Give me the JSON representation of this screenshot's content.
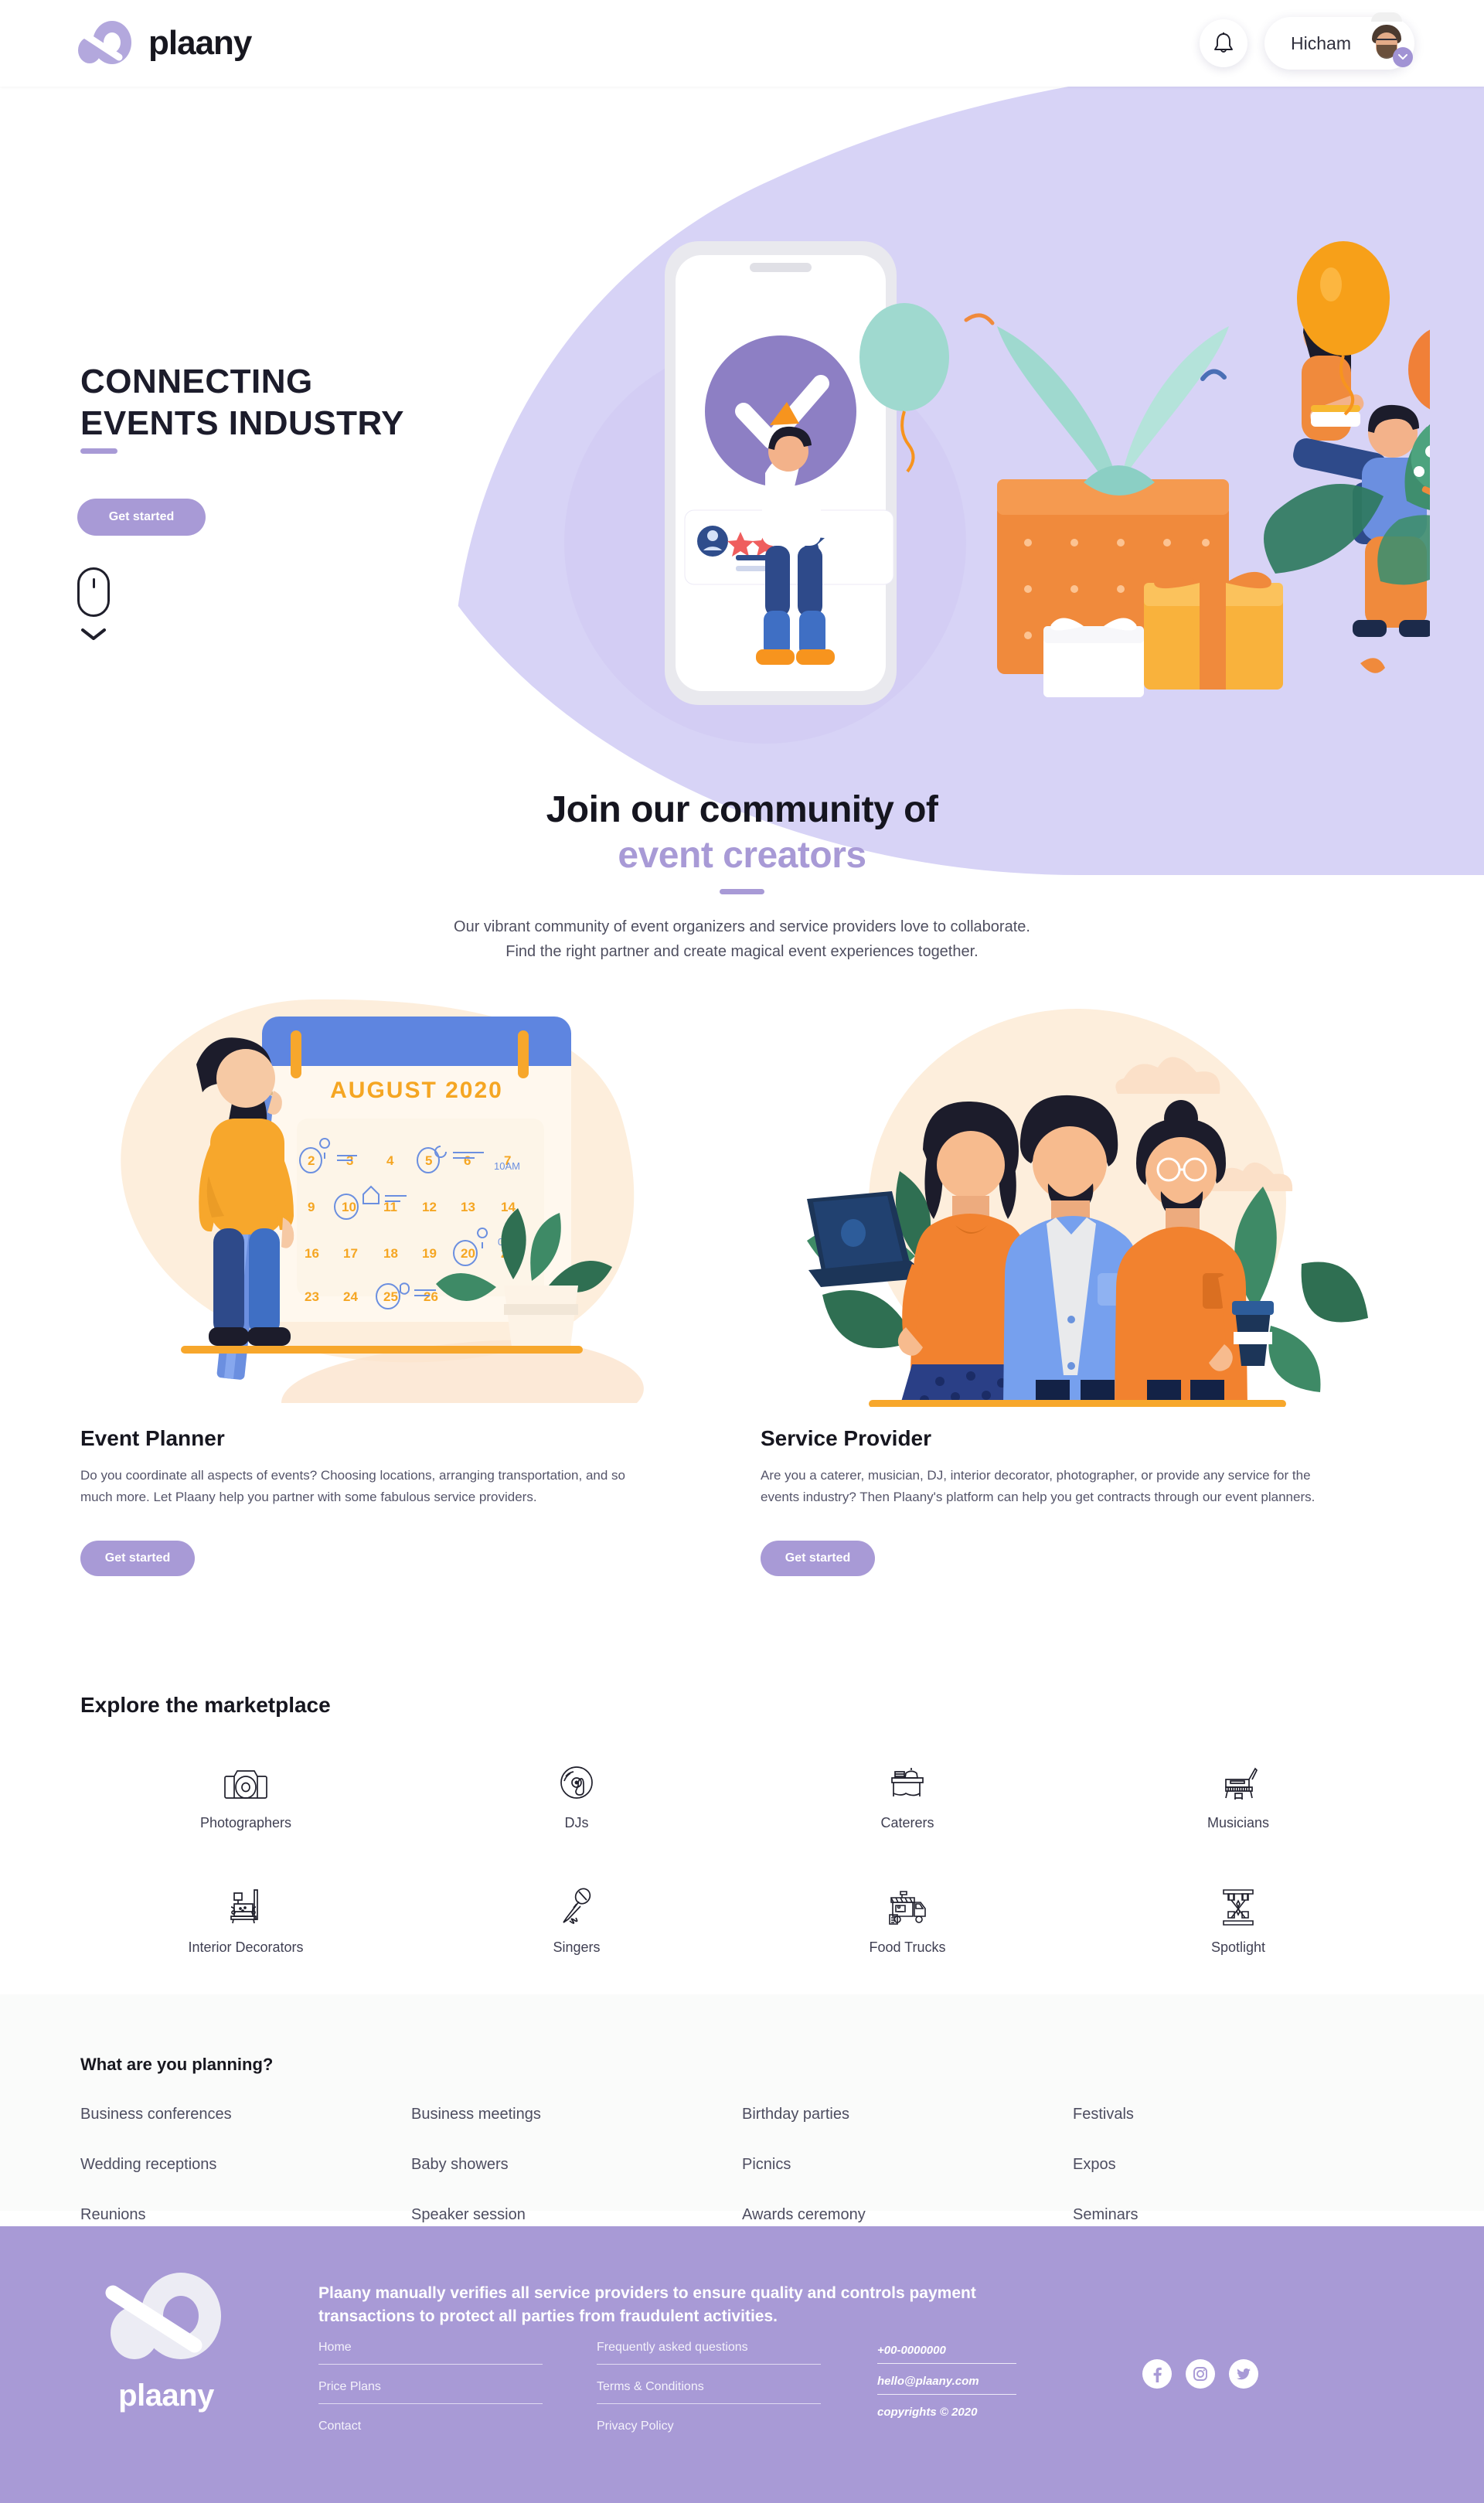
{
  "header": {
    "brand_name": "plaany",
    "notifications_icon": "bell-icon",
    "user_name": "Hicham",
    "chevron_icon": "chevron-down-icon"
  },
  "hero": {
    "title_line1": "CONNECTING",
    "title_line2": "EVENTS INDUSTRY",
    "cta_label": "Get started",
    "scroll_hint_icon": "mouse-scroll-icon"
  },
  "community": {
    "heading_line1": "Join our community of",
    "heading_line2": "event creators",
    "subtitle": "Our vibrant community of event organizers and service providers love to collaborate. Find the right partner and create magical event experiences together."
  },
  "roles": [
    {
      "title": "Event Planner",
      "description": "Do you coordinate all aspects of events? Choosing locations, arranging transportation, and so much more. Let Plaany help you partner with some fabulous service providers.",
      "cta_label": "Get started",
      "illustration": "woman-with-pencil-and-calendar",
      "calendar_title": "AUGUST 2020"
    },
    {
      "title": "Service Provider",
      "description": "Are you a caterer, musician, DJ, interior decorator, photographer, or provide any service for the events industry? Then Plaany's platform can help you get contracts through our event planners.",
      "cta_label": "Get started",
      "illustration": "three-service-providers"
    }
  ],
  "marketplace": {
    "heading": "Explore the marketplace",
    "items": [
      {
        "label": "Photographers",
        "icon": "camera-icon"
      },
      {
        "label": "DJs",
        "icon": "vinyl-record-icon"
      },
      {
        "label": "Caterers",
        "icon": "catering-table-icon"
      },
      {
        "label": "Musicians",
        "icon": "grand-piano-icon"
      },
      {
        "label": "Interior Decorators",
        "icon": "armchair-lamp-icon"
      },
      {
        "label": "Singers",
        "icon": "microphone-icon"
      },
      {
        "label": "Food Trucks",
        "icon": "food-truck-icon"
      },
      {
        "label": "Spotlight",
        "icon": "stage-spotlight-icon"
      }
    ]
  },
  "planning": {
    "heading": "What are you planning?",
    "items": [
      "Business conferences",
      "Business meetings",
      "Birthday parties",
      "Festivals",
      "Wedding receptions",
      "Baby showers",
      "Picnics",
      "Expos",
      "Reunions",
      "Speaker session",
      "Awards ceremony",
      "Seminars"
    ]
  },
  "footer": {
    "brand_name": "plaany",
    "tagline": "Plaany manually verifies all service providers to ensure quality and controls payment transactions to protect all parties from fraudulent activities.",
    "links_col1": [
      "Home",
      "Price Plans",
      "Contact"
    ],
    "links_col2": [
      "Frequently asked questions",
      "Terms & Conditions",
      "Privacy Policy"
    ],
    "contact": [
      "+00-0000000",
      "hello@plaany.com",
      "copyrights © 2020"
    ],
    "social": [
      "facebook-icon",
      "instagram-icon",
      "twitter-icon"
    ]
  },
  "colors": {
    "accent": "#a89ad6",
    "hero_blob": "#d7d3f6",
    "footer_bg": "#a89ad6",
    "planning_bg": "#fafbfa",
    "text_dark": "#16161f",
    "text_muted": "#55556a",
    "orange": "#f7941e",
    "mint": "#8fd3c8",
    "cream": "#fdeedc"
  }
}
